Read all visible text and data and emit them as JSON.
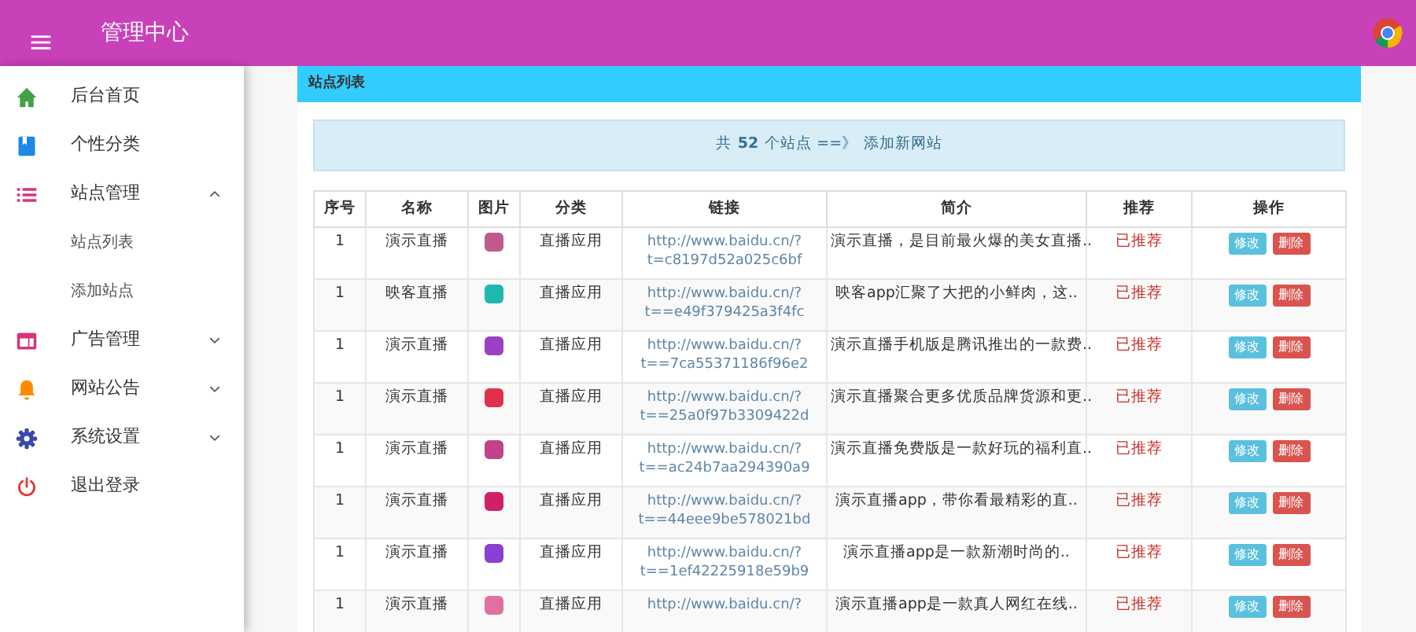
{
  "header": {
    "title": "管理中心"
  },
  "sidebar": {
    "items": [
      {
        "label": "后台首页"
      },
      {
        "label": "个性分类"
      },
      {
        "label": "站点管理",
        "expanded": true,
        "children": [
          {
            "label": "站点列表"
          },
          {
            "label": "添加站点"
          }
        ]
      },
      {
        "label": "广告管理",
        "expanded": false
      },
      {
        "label": "网站公告",
        "expanded": false
      },
      {
        "label": "系统设置",
        "expanded": false
      },
      {
        "label": "退出登录"
      }
    ]
  },
  "panel": {
    "title": "站点列表",
    "summary": {
      "prefix": "共",
      "count": "52",
      "suffix": "个站点 ==》",
      "link": "添加新网站"
    },
    "table": {
      "columns": [
        "序号",
        "名称",
        "图片",
        "分类",
        "链接",
        "简介",
        "推荐",
        "操作"
      ],
      "rows": [
        {
          "no": "1",
          "name": "演示直播",
          "category": "直播应用",
          "link": [
            "http://www.baidu.cn/?",
            "t=c8197d52a025c6bf"
          ],
          "intro": "演示直播，是目前最火爆的美女直播..",
          "recommend": "已推荐",
          "actions": [
            "修改",
            "删除"
          ]
        },
        {
          "no": "1",
          "name": "映客直播",
          "category": "直播应用",
          "link": [
            "http://www.baidu.cn/?",
            "t==e49f379425a3f4fc"
          ],
          "intro": "映客app汇聚了大把的小鲜肉，这..",
          "recommend": "已推荐",
          "actions": [
            "修改",
            "删除"
          ]
        },
        {
          "no": "1",
          "name": "演示直播",
          "category": "直播应用",
          "link": [
            "http://www.baidu.cn/?",
            "t==7ca55371186f96e2"
          ],
          "intro": "演示直播手机版是腾讯推出的一款费..",
          "recommend": "已推荐",
          "actions": [
            "修改",
            "删除"
          ]
        },
        {
          "no": "1",
          "name": "演示直播",
          "category": "直播应用",
          "link": [
            "http://www.baidu.cn/?",
            "t==25a0f97b3309422d"
          ],
          "intro": "演示直播聚合更多优质品牌货源和更..",
          "recommend": "已推荐",
          "actions": [
            "修改",
            "删除"
          ]
        },
        {
          "no": "1",
          "name": "演示直播",
          "category": "直播应用",
          "link": [
            "http://www.baidu.cn/?",
            "t==ac24b7aa294390a9"
          ],
          "intro": "演示直播免费版是一款好玩的福利直..",
          "recommend": "已推荐",
          "actions": [
            "修改",
            "删除"
          ]
        },
        {
          "no": "1",
          "name": "演示直播",
          "category": "直播应用",
          "link": [
            "http://www.baidu.cn/?",
            "t==44eee9be578021bd"
          ],
          "intro": "演示直播app，带你看最精彩的直..",
          "recommend": "已推荐",
          "actions": [
            "修改",
            "删除"
          ]
        },
        {
          "no": "1",
          "name": "演示直播",
          "category": "直播应用",
          "link": [
            "http://www.baidu.cn/?",
            "t==1ef42225918e59b9"
          ],
          "intro": "演示直播app是一款新潮时尚的..",
          "recommend": "已推荐",
          "actions": [
            "修改",
            "删除"
          ]
        },
        {
          "no": "1",
          "name": "演示直播",
          "category": "直播应用",
          "link": [
            "http://www.baidu.cn/?"
          ],
          "intro": "演示直播app是一款真人网红在线..",
          "recommend": "已推荐",
          "actions": [
            "修改",
            "删除"
          ]
        }
      ]
    }
  }
}
